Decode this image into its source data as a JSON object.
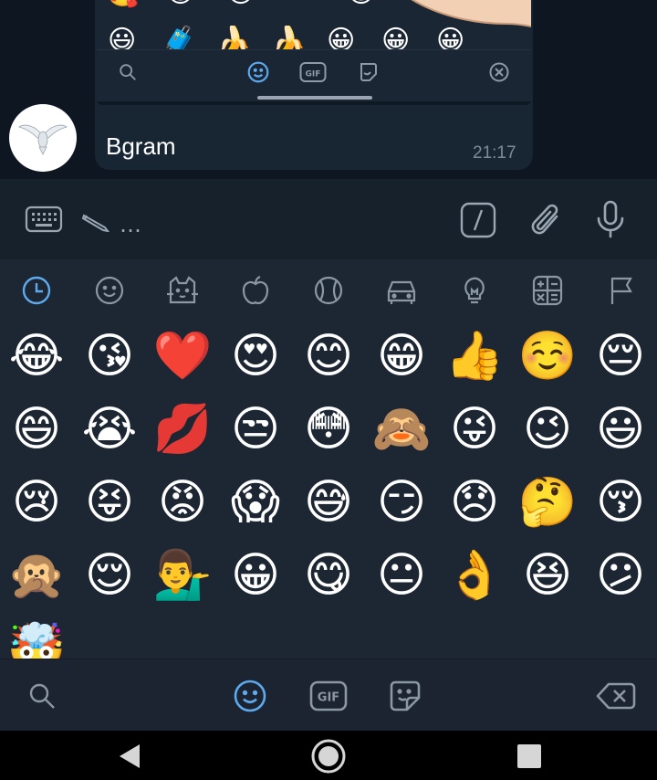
{
  "chat": {
    "sender_name": "Bgram",
    "message_time": "21:17",
    "avatar_icon": "dove-icon",
    "embedded_screenshot": {
      "emojis_row1": [
        "🥰",
        "😆",
        "😚",
        "😃",
        "😍",
        "😆"
      ],
      "emojis_row2": [
        "😃",
        "🧳",
        "🍌",
        "🍌",
        "😀",
        "😀",
        "😀"
      ],
      "bar_icons": [
        "search-icon",
        "emoji-icon",
        "gif-icon",
        "sticker-icon",
        "backspace-icon"
      ],
      "gif_label": "GIF",
      "pointer_icon": "pointing-hand-icon"
    }
  },
  "input": {
    "typing_indicator": "✎ ...",
    "left_icon": "keyboard-icon",
    "right_icons": [
      "command-icon",
      "attach-icon",
      "microphone-icon"
    ]
  },
  "emoji_panel": {
    "category_icons": [
      "recent-clock-icon",
      "smiley-icon",
      "cat-icon",
      "apple-icon",
      "ball-icon",
      "car-icon",
      "bulb-icon",
      "symbols-icon",
      "flag-icon"
    ],
    "active_category": "recent-clock-icon",
    "rows": [
      [
        "😂",
        "😘",
        "❤️",
        "😍",
        "😊",
        "😁",
        "👍",
        "☺️",
        "😔"
      ],
      [
        "😄",
        "😭",
        "💋",
        "😒",
        "😳",
        "🙈",
        "😜",
        "😉",
        "😃"
      ],
      [
        "😢",
        "😝",
        "😡",
        "😱",
        "😅",
        "😏",
        "😞",
        "🤔",
        "😚"
      ],
      [
        "🙊",
        "😌",
        "💁‍♂️",
        "😀",
        "😋",
        "😐",
        "👌",
        "😆",
        "😕"
      ],
      [
        "🤯"
      ]
    ],
    "bottom_tabs": [
      "search-icon",
      "emoji-icon",
      "gif-icon",
      "sticker-icon"
    ],
    "gif_label": "GIF",
    "active_tab": "emoji-icon",
    "delete_icon": "backspace-icon"
  },
  "navigation": [
    "back-icon",
    "home-icon",
    "recents-icon"
  ],
  "colors": {
    "accent": "#5eaaef",
    "panel_bg": "#1d2733",
    "chat_bg": "#0e1621",
    "icon": "#8b97a4"
  }
}
